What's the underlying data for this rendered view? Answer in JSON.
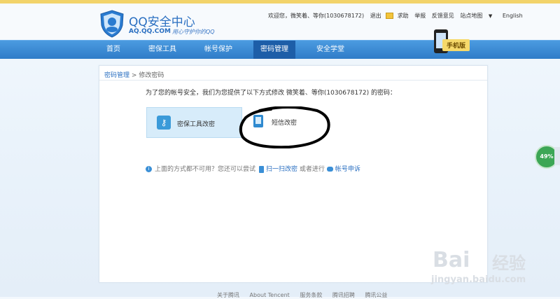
{
  "header": {
    "brand": "QQ安全中心",
    "url": "AQ.QQ.COM",
    "slogan": "用心守护你的QQ",
    "welcome": "欢迎您，微笑着、等你(1030678172)",
    "logout": "退出",
    "help": "求助",
    "report": "举报",
    "feedback": "反馈意见",
    "sitemap": "站点地图",
    "language": "English"
  },
  "nav": {
    "items": [
      "首页",
      "密保工具",
      "帐号保护",
      "密码管理",
      "安全学堂"
    ],
    "active_index": 3,
    "mobile_tag": "手机版"
  },
  "breadcrumb": {
    "parent": "密码管理",
    "separator": ">",
    "current": "修改密码"
  },
  "main": {
    "intro": "为了您的帐号安全，我们为您提供了以下方式修改 微笑着、等你(1030678172) 的密码：",
    "option_tool": "密保工具改密",
    "option_sms": "短信改密",
    "help_prefix": "上面的方式都不可用？您还可以尝试",
    "scan_link": "扫一扫改密",
    "help_middle": "或者进行",
    "appeal_link": "帐号申诉"
  },
  "badge": {
    "percent": "49%"
  },
  "footer": {
    "links": [
      "关于腾讯",
      "About Tencent",
      "服务条款",
      "腾讯招聘",
      "腾讯公益"
    ]
  },
  "watermark": {
    "text": "Bai",
    "cn": "经验",
    "url": "jingyan.baidu.com"
  }
}
